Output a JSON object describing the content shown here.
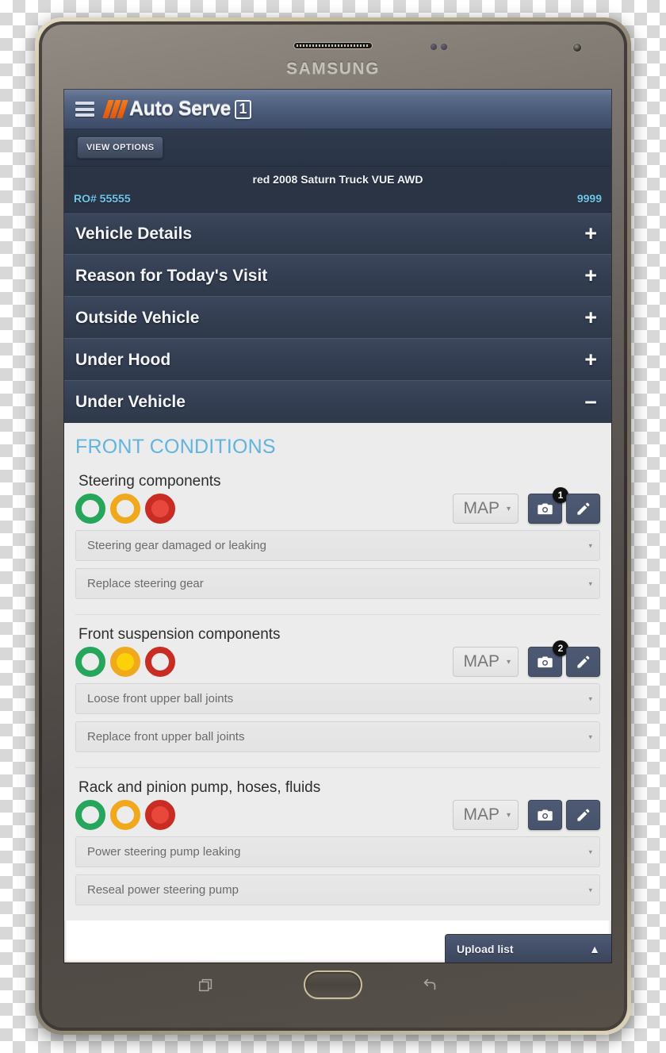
{
  "device": {
    "brand": "SAMSUNG",
    "nav": {
      "recents_label": "recents-icon",
      "home_label": "home-button",
      "back_label": "back-icon"
    }
  },
  "app": {
    "logo": {
      "name_text": "Auto Serve",
      "badge_text": "1",
      "slash_color": "#f3690f"
    },
    "menu_icon": "hamburger-icon",
    "view_options_label": "VIEW OPTIONS"
  },
  "vehicle": {
    "title": "red 2008 Saturn Truck VUE AWD",
    "ro_label": "RO# 55555",
    "mileage": "9999"
  },
  "accordion": {
    "sections": [
      {
        "label": "Vehicle Details",
        "toggle": "+",
        "open": false
      },
      {
        "label": "Reason for Today's Visit",
        "toggle": "+",
        "open": false
      },
      {
        "label": "Outside Vehicle",
        "toggle": "+",
        "open": false
      },
      {
        "label": "Under Hood",
        "toggle": "+",
        "open": false
      },
      {
        "label": "Under Vehicle",
        "toggle": "−",
        "open": true
      }
    ]
  },
  "panel": {
    "group_title": "FRONT CONDITIONS",
    "map_label": "MAP",
    "map_caret": "▾",
    "select_caret": "▾",
    "status_colors": {
      "green": "#25a65b",
      "amber": "#f0a81c",
      "amber_fill": "#fbd107",
      "red": "#c92c22",
      "red_fill": "#e8473c"
    },
    "items": [
      {
        "label": "Steering components",
        "status": "red",
        "photo_count": "1",
        "condition": "Steering gear damaged or leaking",
        "recommendation": "Replace steering gear"
      },
      {
        "label": "Front suspension components",
        "status": "amber",
        "photo_count": "2",
        "condition": "Loose front upper ball joints",
        "recommendation": "Replace front upper ball joints"
      },
      {
        "label": "Rack and pinion pump, hoses, fluids",
        "status": "red",
        "photo_count": "",
        "condition": "Power steering pump leaking",
        "recommendation": "Reseal power steering pump"
      }
    ]
  },
  "upload": {
    "label": "Upload list",
    "chevron": "▲"
  }
}
